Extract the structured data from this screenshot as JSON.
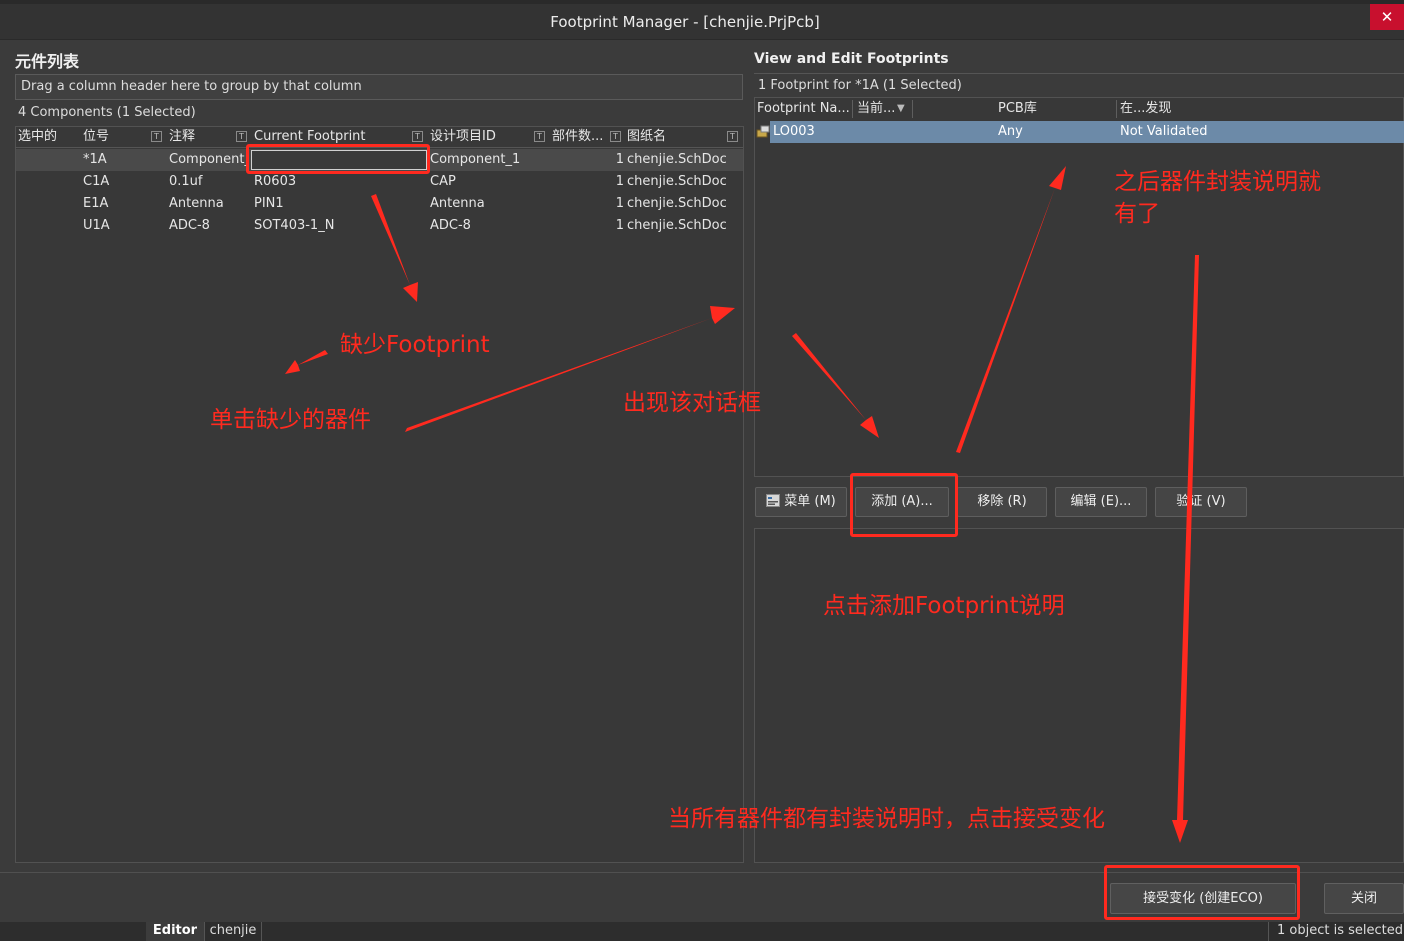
{
  "window": {
    "title": "Footprint Manager - [chenjie.PrjPcb]",
    "close_glyph": "✕"
  },
  "left": {
    "title": "元件列表",
    "group_hint": "Drag a column header here to group by that column",
    "count_label": "4 Components (1 Selected)",
    "columns": [
      "选中的",
      "位号",
      "注释",
      "Current Footprint",
      "设计项目ID",
      "部件数...",
      "图纸名"
    ],
    "rows": [
      {
        "selected": "",
        "designator": "*1A",
        "comment": "Component_",
        "footprint": "",
        "design_id": "Component_1",
        "parts": "1",
        "sheet": "chenjie.SchDoc"
      },
      {
        "selected": "",
        "designator": "C1A",
        "comment": "0.1uf",
        "footprint": "R0603",
        "design_id": "CAP",
        "parts": "1",
        "sheet": "chenjie.SchDoc"
      },
      {
        "selected": "",
        "designator": "E1A",
        "comment": "Antenna",
        "footprint": "PIN1",
        "design_id": "Antenna",
        "parts": "1",
        "sheet": "chenjie.SchDoc"
      },
      {
        "selected": "",
        "designator": "U1A",
        "comment": "ADC-8",
        "footprint": "SOT403-1_N",
        "design_id": "ADC-8",
        "parts": "1",
        "sheet": "chenjie.SchDoc"
      }
    ]
  },
  "right": {
    "title": "View and Edit Footprints",
    "count_label": "1 Footprint for *1A (1 Selected)",
    "columns": [
      "Footprint Na...",
      "当前...",
      "PCB库",
      "在...发现"
    ],
    "row": {
      "name": "LO003",
      "current": "",
      "library": "Any",
      "found": "Not Validated"
    },
    "buttons": {
      "menu": "菜单 (M)",
      "add": "添加 (A)...",
      "remove": "移除 (R)",
      "edit": "编辑 (E)...",
      "validate": "验证 (V)"
    }
  },
  "bottom": {
    "accept": "接受变化 (创建ECO)",
    "close": "关闭"
  },
  "statusbar": {
    "tab_editor": "Editor",
    "tab_project": "chenjie",
    "status": "1 object is selected"
  },
  "annotations": {
    "missing_footprint": "缺少Footprint",
    "click_missing": "单击缺少的器件",
    "dialog_appears": "出现该对话框",
    "after_added_line1": "之后器件封装说明就",
    "after_added_line2": "有了",
    "click_add": "点击添加Footprint说明",
    "accept_hint": "当所有器件都有封装说明时，点击接受变化"
  },
  "colors": {
    "annotation_red": "#ff2a1f",
    "selected_row": "#6c8aa8",
    "close_button": "#c8102e"
  }
}
